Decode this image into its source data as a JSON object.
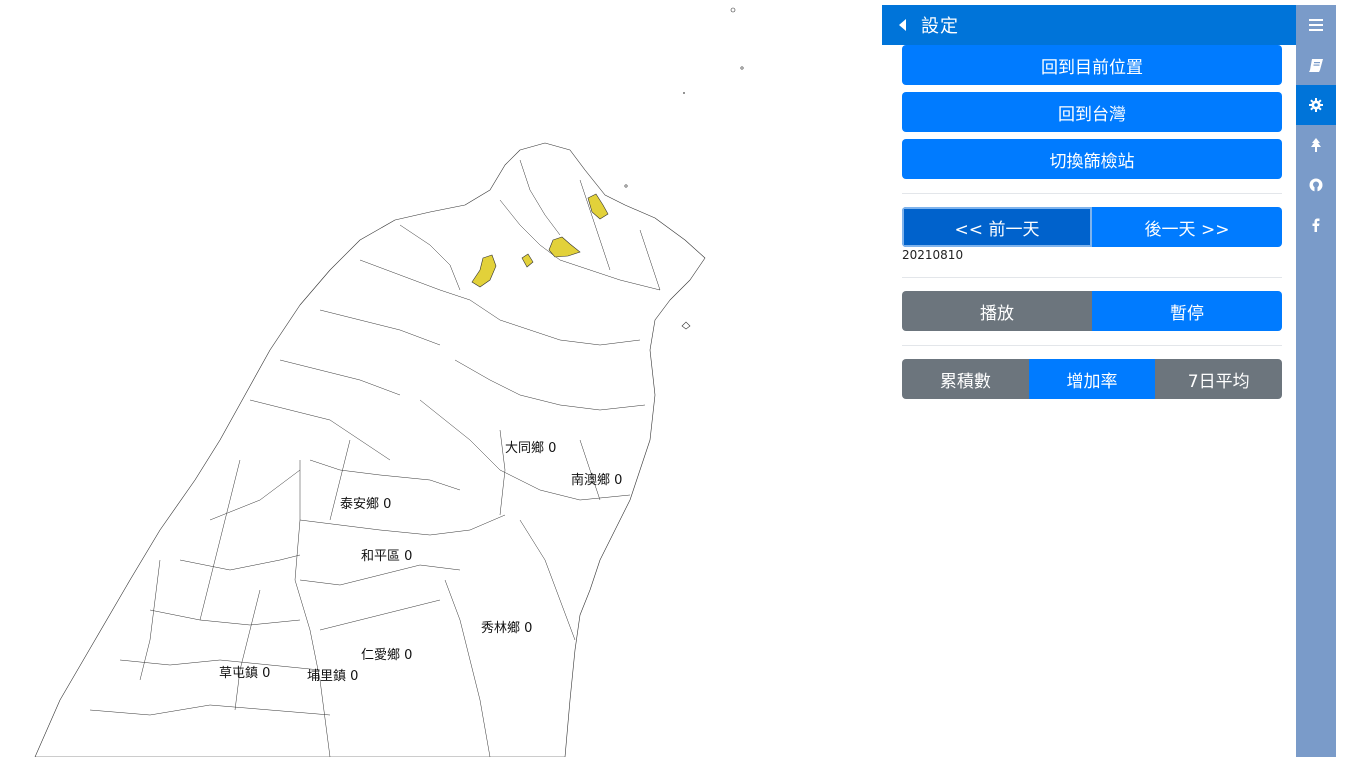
{
  "map": {
    "labels": [
      {
        "name": "大同鄉",
        "value": "0"
      },
      {
        "name": "南澳鄉",
        "value": "0"
      },
      {
        "name": "泰安鄉",
        "value": "0"
      },
      {
        "name": "和平區",
        "value": "0"
      },
      {
        "name": "秀林鄉",
        "value": "0"
      },
      {
        "name": "仁愛鄉",
        "value": "0"
      },
      {
        "name": "草屯鎮",
        "value": "0"
      },
      {
        "name": "埔里鎮",
        "value": "0"
      }
    ],
    "colors": {
      "highlight": "#e2d13a",
      "border": "#333333",
      "fill": "#ffffff"
    }
  },
  "panel": {
    "title": "設定",
    "buttons": {
      "current_location": "回到目前位置",
      "back_taiwan": "回到台灣",
      "switch_station": "切換篩檢站"
    },
    "day_nav": {
      "prev": "<< 前一天",
      "next": "後一天 >>"
    },
    "date": "20210810",
    "playback": {
      "play": "播放",
      "pause": "暫停"
    },
    "modes": {
      "cumulative": "累積數",
      "growth": "增加率",
      "avg7": "7日平均"
    }
  },
  "sidebar": {
    "tabs": [
      "menu-icon",
      "book-icon",
      "gear-icon",
      "tree-icon",
      "github-icon",
      "facebook-icon"
    ],
    "active": "gear-icon"
  },
  "colors": {
    "primary": "#007bff",
    "header": "#0074d9",
    "secondary": "#6c757d",
    "sidebar": "#7a9bc9"
  }
}
